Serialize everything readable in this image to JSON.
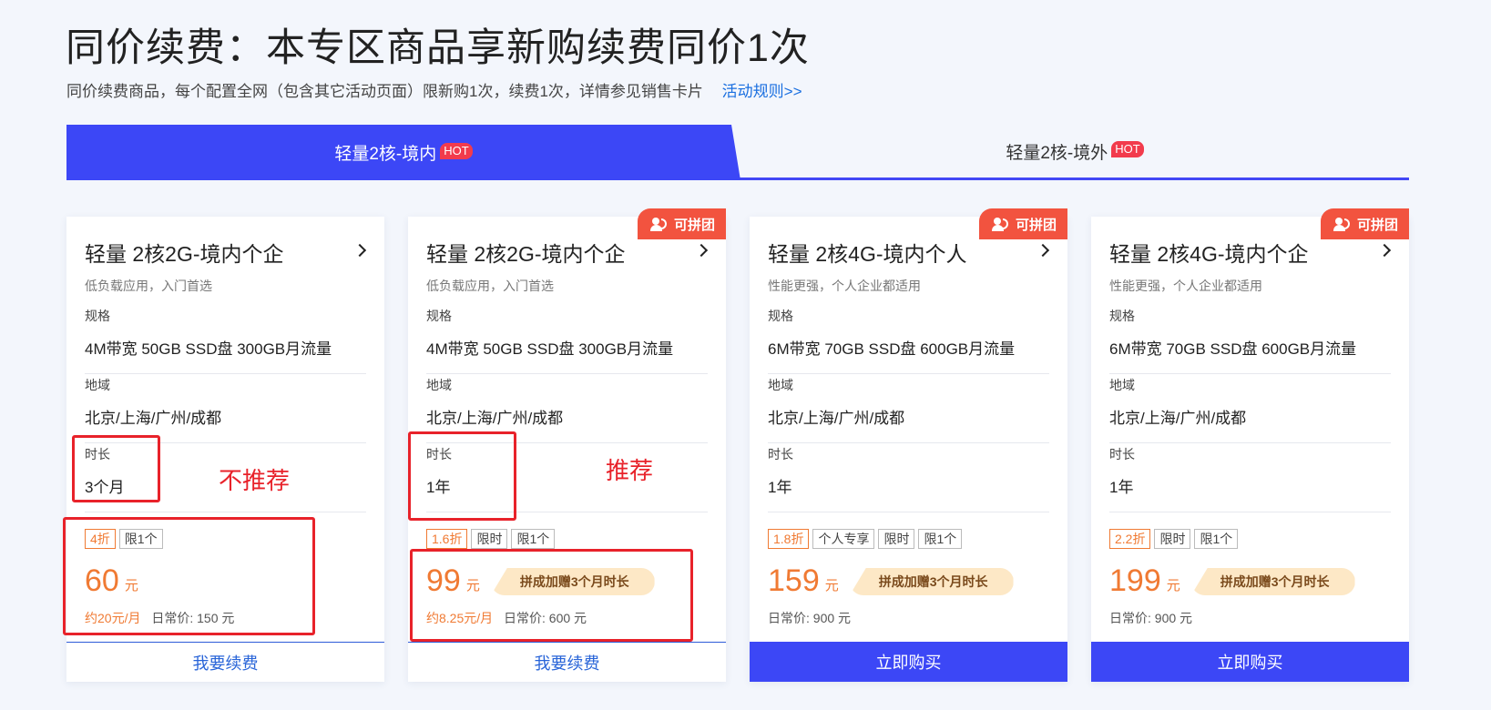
{
  "title": "同价续费：本专区商品享新购续费同价1次",
  "subtitle": "同价续费商品，每个配置全网（包含其它活动页面）限新购1次，续费1次，详情参见销售卡片",
  "rules_link": "活动规则>>",
  "tabs": [
    {
      "label": "轻量2核-境内",
      "hot": "HOT"
    },
    {
      "label": "轻量2核-境外",
      "hot": "HOT"
    }
  ],
  "field_labels": {
    "spec": "规格",
    "region": "地域",
    "duration": "时长"
  },
  "cards": [
    {
      "name": "轻量 2核2G-境内个企",
      "desc": "低负载应用，入门首选",
      "spec": "4M带宽 50GB SSD盘 300GB月流量",
      "region": "北京/上海/广州/成都",
      "duration": "3个月",
      "tags": [
        "4折",
        "限1个"
      ],
      "price": "60",
      "unit": "元",
      "monthly": "约20元/月",
      "regular": "日常价: 150 元",
      "action": "我要续费"
    },
    {
      "badge": "可拼团",
      "name": "轻量 2核2G-境内个企",
      "desc": "低负载应用，入门首选",
      "spec": "4M带宽 50GB SSD盘 300GB月流量",
      "region": "北京/上海/广州/成都",
      "duration": "1年",
      "tags": [
        "1.6折",
        "限时",
        "限1个"
      ],
      "price": "99",
      "unit": "元",
      "promo": "拼成加赠3个月时长",
      "monthly": "约8.25元/月",
      "regular": "日常价: 600 元",
      "action": "我要续费"
    },
    {
      "badge": "可拼团",
      "name": "轻量 2核4G-境内个人",
      "desc": "性能更强，个人企业都适用",
      "spec": "6M带宽 70GB SSD盘 600GB月流量",
      "region": "北京/上海/广州/成都",
      "duration": "1年",
      "tags": [
        "1.8折",
        "个人专享",
        "限时",
        "限1个"
      ],
      "price": "159",
      "unit": "元",
      "promo": "拼成加赠3个月时长",
      "regular": "日常价: 900 元",
      "action": "立即购买"
    },
    {
      "badge": "可拼团",
      "name": "轻量 2核4G-境内个企",
      "desc": "性能更强，个人企业都适用",
      "spec": "6M带宽 70GB SSD盘 600GB月流量",
      "region": "北京/上海/广州/成都",
      "duration": "1年",
      "tags": [
        "2.2折",
        "限时",
        "限1个"
      ],
      "price": "199",
      "unit": "元",
      "promo": "拼成加赠3个月时长",
      "regular": "日常价: 900 元",
      "action": "立即购买"
    }
  ],
  "annotations": {
    "not_recommended": "不推荐",
    "recommended": "推荐"
  }
}
